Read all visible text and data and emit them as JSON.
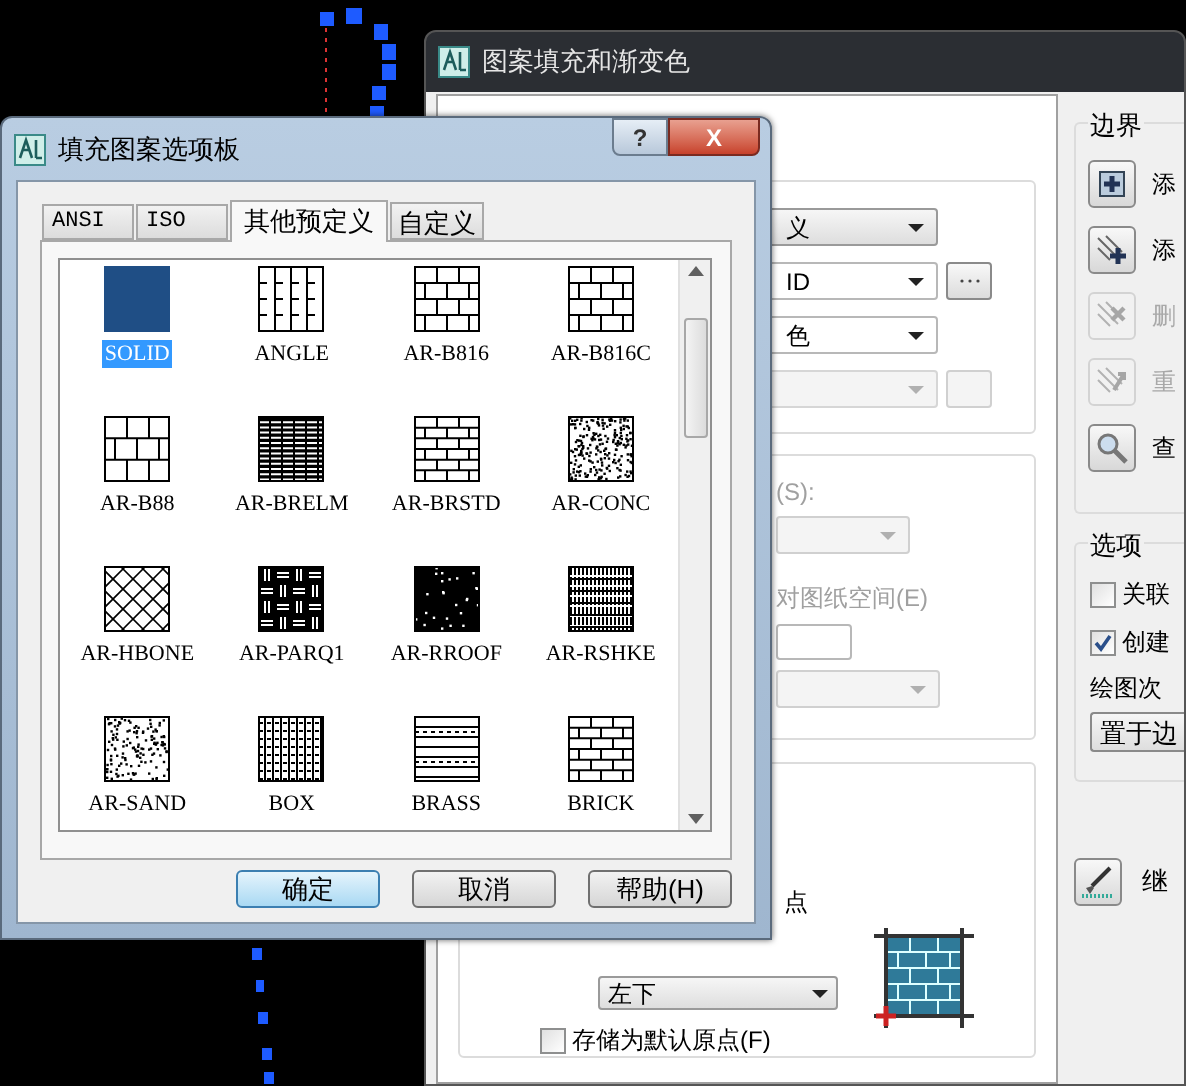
{
  "hatch_dialog": {
    "title": "图案填充和渐变色",
    "type_dropdown": {
      "value": "义"
    },
    "pattern_dropdown": {
      "value": "ID"
    },
    "color_dropdown": {
      "value": "色"
    },
    "angle_label": {
      "text": "(S):",
      "disabled": true
    },
    "paper_space_label": {
      "text": "对图纸空间(E)",
      "disabled": true
    },
    "origin_label": {
      "text": "点"
    },
    "origin_dropdown": {
      "value": "左下"
    },
    "store_default": {
      "label": "存储为默认原点(F)",
      "checked": false
    },
    "boundary": {
      "title": "边界",
      "buttons": [
        {
          "label": "添",
          "disabled": false
        },
        {
          "label": "添",
          "disabled": false
        },
        {
          "label": "删",
          "disabled": true
        },
        {
          "label": "重",
          "disabled": true
        },
        {
          "label": "查",
          "disabled": false
        }
      ]
    },
    "options": {
      "title": "选项",
      "checkboxes": [
        {
          "label": "关联",
          "checked": false
        },
        {
          "label": "创建",
          "checked": true
        }
      ],
      "draw_order_label": "绘图次",
      "draw_order_value": "置于边"
    },
    "inherit_button": {
      "label": "继"
    }
  },
  "palette_dialog": {
    "title": "填充图案选项板",
    "help_button": "?",
    "close_button": "X",
    "tabs": [
      {
        "label": "ANSI",
        "selected": false
      },
      {
        "label": "ISO",
        "selected": false
      },
      {
        "label": "其他预定义",
        "selected": true
      },
      {
        "label": "自定义",
        "selected": false
      }
    ],
    "patterns": [
      {
        "name": "SOLID",
        "selected": true
      },
      {
        "name": "ANGLE",
        "selected": false
      },
      {
        "name": "AR-B816",
        "selected": false
      },
      {
        "name": "AR-B816C",
        "selected": false
      },
      {
        "name": "AR-B88",
        "selected": false
      },
      {
        "name": "AR-BRELM",
        "selected": false
      },
      {
        "name": "AR-BRSTD",
        "selected": false
      },
      {
        "name": "AR-CONC",
        "selected": false
      },
      {
        "name": "AR-HBONE",
        "selected": false
      },
      {
        "name": "AR-PARQ1",
        "selected": false
      },
      {
        "name": "AR-RROOF",
        "selected": false
      },
      {
        "name": "AR-RSHKE",
        "selected": false
      },
      {
        "name": "AR-SAND",
        "selected": false
      },
      {
        "name": "BOX",
        "selected": false
      },
      {
        "name": "BRASS",
        "selected": false
      },
      {
        "name": "BRICK",
        "selected": false
      }
    ],
    "buttons": [
      {
        "label": "确定",
        "default": true
      },
      {
        "label": "取消",
        "default": false
      },
      {
        "label": "帮助(H)",
        "default": false
      }
    ]
  }
}
